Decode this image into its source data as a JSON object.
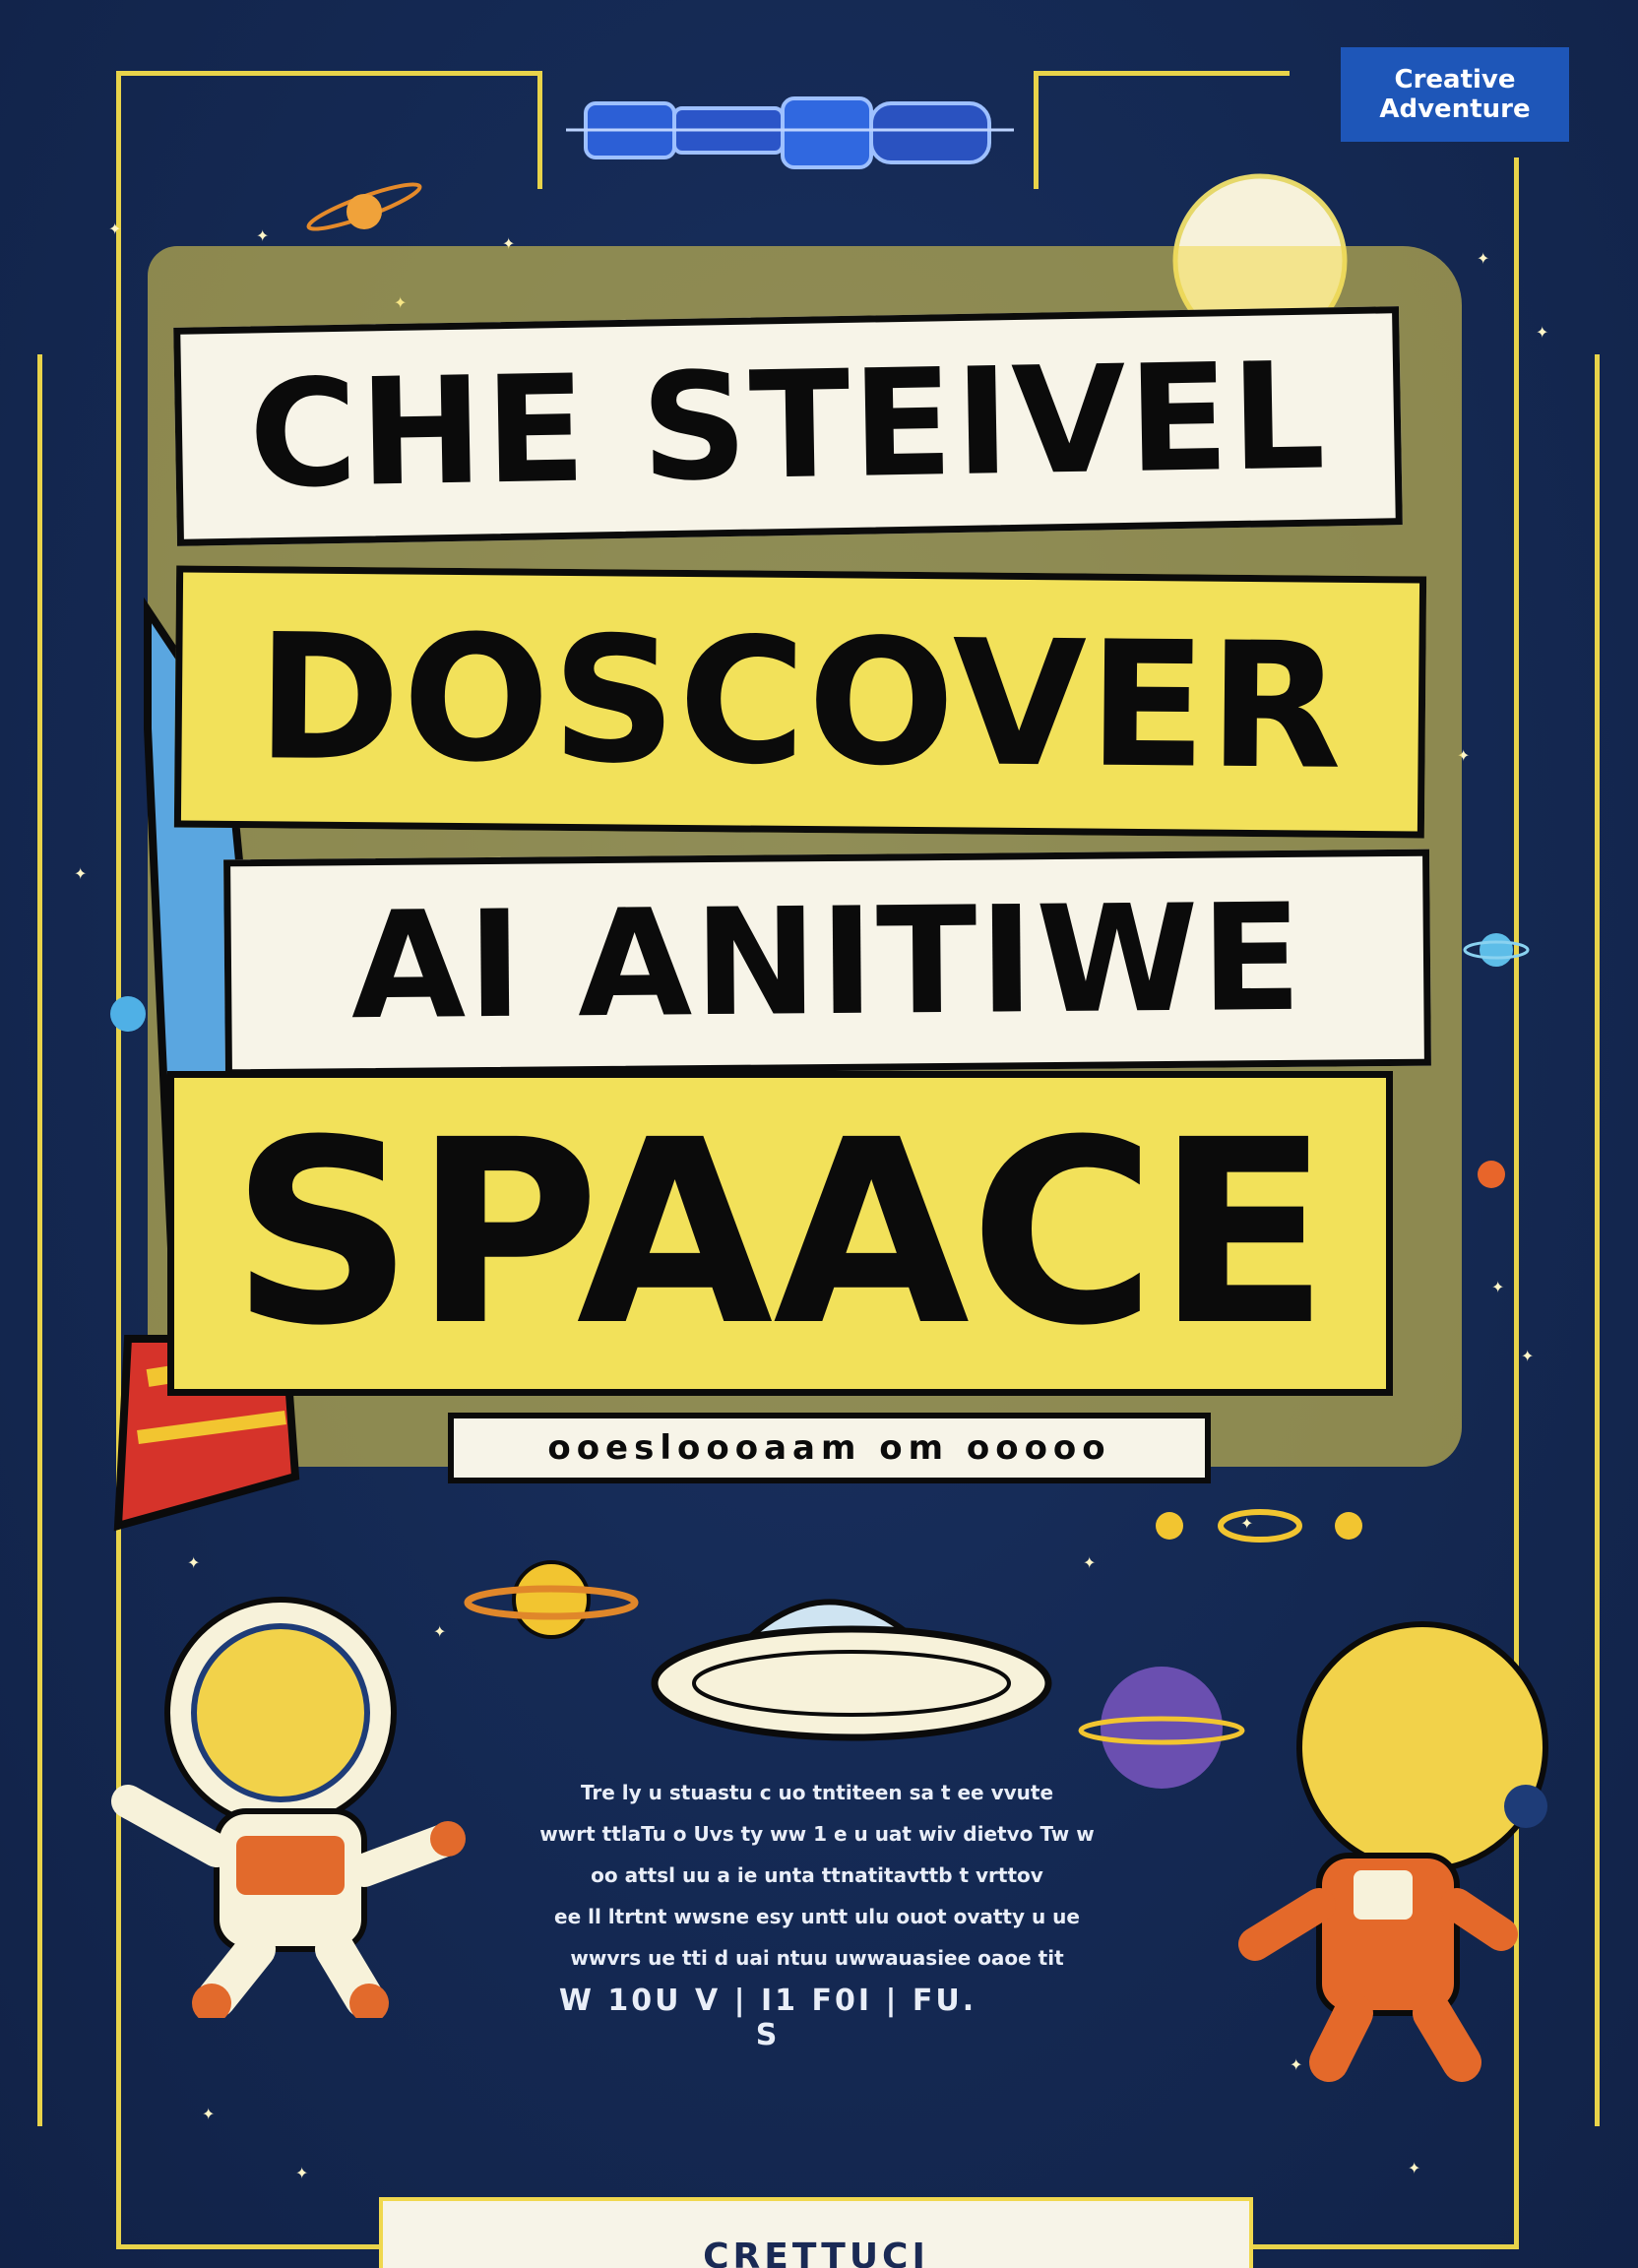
{
  "logo": {
    "line1": "Creative",
    "line2": "Adventure"
  },
  "title": {
    "line1": "CHE STEIVEL",
    "line2": "DOSCOVER",
    "line3": "AI ANITIWE",
    "line4": "SPAACE"
  },
  "tagline": "ooesloooaam om ooooo",
  "body_lines": [
    "Tre ly u stuastu c uo tntiteen sa t ee vvute",
    "wwrt ttlaTu o Uvs ty ww 1 e u uat wiv dietvo Tw w",
    "oo attsl uu a ie unta ttnatitavttb t vrttov",
    "ee ll ltrtnt wwsne   esy untt ulu ouot ovatty u ue",
    "wwvrs ue  tti  d   uai  ntuu  uwwauasiee  oaoe tit"
  ],
  "credits": "W 10U V  |  I1 F0I  |  FU. S",
  "footer": "CRETTUCI",
  "colors": {
    "background": "#14264f",
    "accent_yellow": "#f2e15a",
    "paper": "#f7f4e8",
    "ink": "#0b0b0b"
  }
}
